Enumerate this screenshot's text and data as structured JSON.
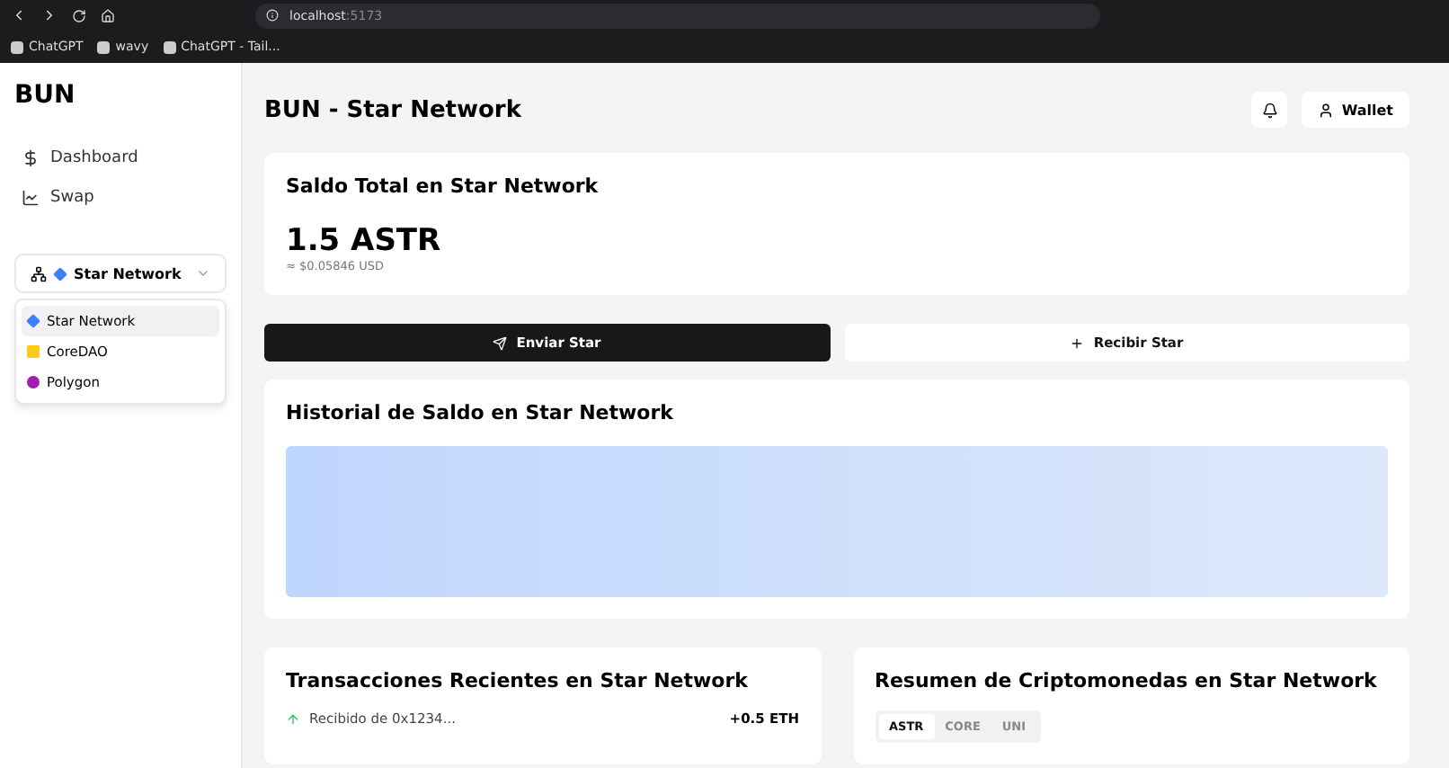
{
  "browser": {
    "url": "localhost",
    "port": ":5173",
    "bookmarks": [
      "ChatGPT",
      "wavy",
      "ChatGPT - Tail..."
    ]
  },
  "sidebar": {
    "brand": "BUN",
    "items": [
      {
        "label": "Dashboard"
      },
      {
        "label": "Swap"
      }
    ],
    "network_select": {
      "value": "Star Network",
      "color": "#3b82f6",
      "expanded": true,
      "options": [
        {
          "label": "Star Network",
          "color": "#3b82f6",
          "selected": true
        },
        {
          "label": "CoreDAO",
          "color": "#facc15",
          "selected": false
        },
        {
          "label": "Polygon",
          "color": "#a21caf",
          "selected": false
        }
      ]
    }
  },
  "header": {
    "title": "BUN - Star Network",
    "wallet_button": "Wallet"
  },
  "balance": {
    "title": "Saldo Total en Star Network",
    "amount": "1.5 ASTR",
    "usd": "≈ $0.05846 USD"
  },
  "actions": [
    {
      "label": "Enviar Star",
      "kind": "send"
    },
    {
      "label": "Recibir Star",
      "kind": "receive"
    }
  ],
  "history": {
    "title": "Historial de Saldo en Star Network"
  },
  "transactions": {
    "title": "Transacciones Recientes en Star Network",
    "rows": [
      {
        "label": "Recibido de 0x1234...",
        "amount": "+0.5 ETH"
      }
    ]
  },
  "summary": {
    "title": "Resumen de Criptomonedas en Star Network",
    "tabs": [
      {
        "label": "ASTR",
        "selected": true
      },
      {
        "label": "CORE",
        "selected": false
      },
      {
        "label": "UNI",
        "selected": false
      }
    ]
  }
}
